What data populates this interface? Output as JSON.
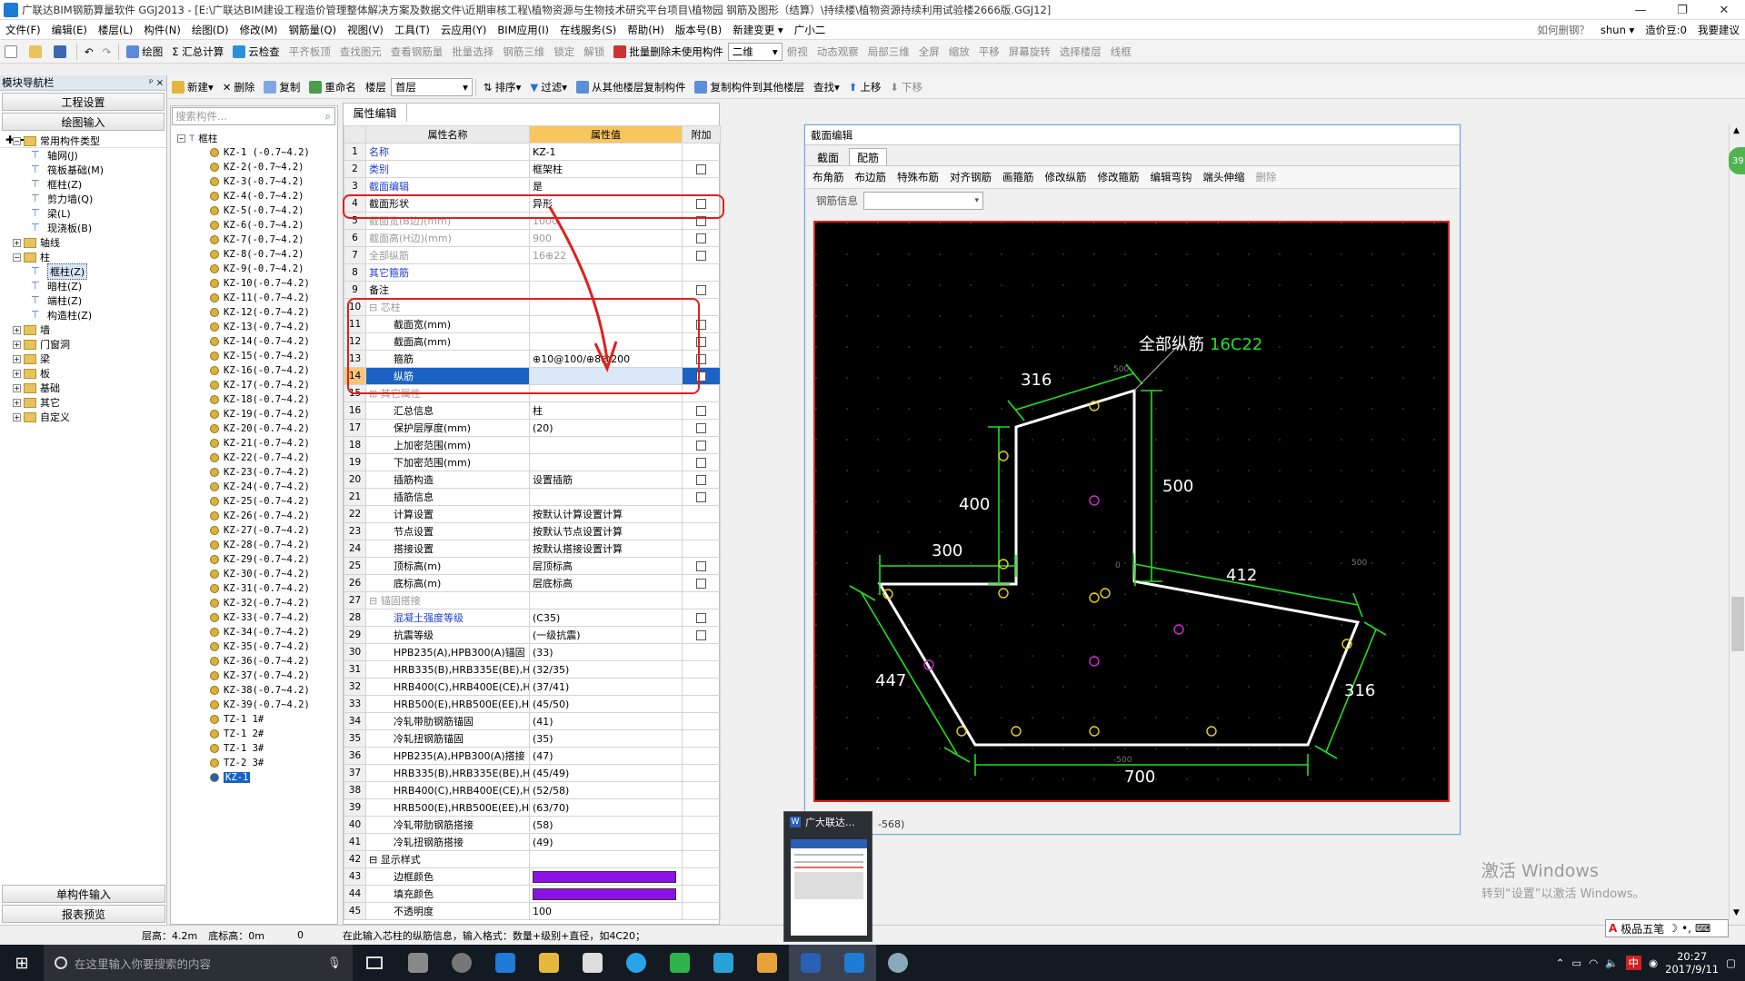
{
  "title": "广联达BIM钢筋算量软件 GGJ2013 - [E:\\广联达BIM建设工程造价管理整体解决方案及数据文件\\近期审核工程\\植物资源与生物技术研究平台项目\\植物园 钢筋及图形（结算）\\持续楼\\植物资源持续利用试验楼2666版.GGJ12]",
  "menu": [
    "文件(F)",
    "编辑(E)",
    "楼层(L)",
    "构件(N)",
    "绘图(D)",
    "修改(M)",
    "钢筋量(Q)",
    "视图(V)",
    "工具(T)",
    "云应用(Y)",
    "BIM应用(I)",
    "在线服务(S)",
    "帮助(H)",
    "版本号(B)",
    "新建变更 ▾",
    "广小二"
  ],
  "menu_right": {
    "help": "如何删钢？",
    "user": "shun ▾",
    "cost": "造价豆:0",
    "ask": "我要建议"
  },
  "toolbar1": [
    "绘图",
    "Σ 汇总计算",
    "云检查",
    "平齐板顶",
    "查找图元",
    "查看钢筋量",
    "批量选择",
    "钢筋三维",
    "锁定",
    "解锁",
    "批量删除未使用构件",
    "二维",
    "俯视",
    "动态观察",
    "局部三维",
    "全屏",
    "缩放",
    "平移",
    "屏幕旋转",
    "选择楼层",
    "线框"
  ],
  "toolbar2": [
    "新建",
    "删除",
    "复制",
    "重命名",
    "楼层",
    "首层",
    "排序",
    "过滤",
    "从其他楼层复制构件",
    "复制构件到其他楼层",
    "查找",
    "上移",
    "下移"
  ],
  "nav": {
    "header": "模块导航栏",
    "pin": "ᵖ ×",
    "btn1": "工程设置",
    "btn2": "绘图输入",
    "btn3": "单构件输入",
    "btn4": "报表预览",
    "tree": [
      {
        "l": 0,
        "t": "常用构件类型",
        "f": true
      },
      {
        "l": 2,
        "t": "轴网(J)"
      },
      {
        "l": 2,
        "t": "筏板基础(M)"
      },
      {
        "l": 2,
        "t": "框柱(Z)"
      },
      {
        "l": 2,
        "t": "剪力墙(Q)"
      },
      {
        "l": 2,
        "t": "梁(L)"
      },
      {
        "l": 2,
        "t": "现浇板(B)"
      },
      {
        "l": 0,
        "t": "轴线",
        "f": true,
        "c": true
      },
      {
        "l": 0,
        "t": "柱",
        "f": true
      },
      {
        "l": 2,
        "t": "框柱(Z)",
        "sel": true
      },
      {
        "l": 2,
        "t": "暗柱(Z)"
      },
      {
        "l": 2,
        "t": "端柱(Z)"
      },
      {
        "l": 2,
        "t": "构造柱(Z)"
      },
      {
        "l": 0,
        "t": "墙",
        "f": true,
        "c": true
      },
      {
        "l": 0,
        "t": "门窗洞",
        "f": true,
        "c": true
      },
      {
        "l": 0,
        "t": "梁",
        "f": true,
        "c": true
      },
      {
        "l": 0,
        "t": "板",
        "f": true,
        "c": true
      },
      {
        "l": 0,
        "t": "基础",
        "f": true,
        "c": true
      },
      {
        "l": 0,
        "t": "其它",
        "f": true,
        "c": true
      },
      {
        "l": 0,
        "t": "自定义",
        "f": true,
        "c": true
      }
    ]
  },
  "search_placeholder": "搜索构件...",
  "component_root": "框柱",
  "components": [
    "KZ-1 (-0.7~4.2)",
    "KZ-2(-0.7~4.2)",
    "KZ-3(-0.7~4.2)",
    "KZ-4(-0.7~4.2)",
    "KZ-5(-0.7~4.2)",
    "KZ-6(-0.7~4.2)",
    "KZ-7(-0.7~4.2)",
    "KZ-8(-0.7~4.2)",
    "KZ-9(-0.7~4.2)",
    "KZ-10(-0.7~4.2)",
    "KZ-11(-0.7~4.2)",
    "KZ-12(-0.7~4.2)",
    "KZ-13(-0.7~4.2)",
    "KZ-14(-0.7~4.2)",
    "KZ-15(-0.7~4.2)",
    "KZ-16(-0.7~4.2)",
    "KZ-17(-0.7~4.2)",
    "KZ-18(-0.7~4.2)",
    "KZ-19(-0.7~4.2)",
    "KZ-20(-0.7~4.2)",
    "KZ-21(-0.7~4.2)",
    "KZ-22(-0.7~4.2)",
    "KZ-23(-0.7~4.2)",
    "KZ-24(-0.7~4.2)",
    "KZ-25(-0.7~4.2)",
    "KZ-26(-0.7~4.2)",
    "KZ-27(-0.7~4.2)",
    "KZ-28(-0.7~4.2)",
    "KZ-29(-0.7~4.2)",
    "KZ-30(-0.7~4.2)",
    "KZ-31(-0.7~4.2)",
    "KZ-32(-0.7~4.2)",
    "KZ-33(-0.7~4.2)",
    "KZ-34(-0.7~4.2)",
    "KZ-35(-0.7~4.2)",
    "KZ-36(-0.7~4.2)",
    "KZ-37(-0.7~4.2)",
    "KZ-38(-0.7~4.2)",
    "KZ-39(-0.7~4.2)",
    "TZ-1 1#",
    "TZ-1 2#",
    "TZ-1 3#",
    "TZ-2 3#",
    "KZ-1"
  ],
  "prop": {
    "tab": "属性编辑",
    "col_name": "属性名称",
    "col_value": "属性值",
    "col_extra": "附加",
    "rows": [
      {
        "n": "1",
        "name": "名称",
        "v": "KZ-1",
        "c": "blue",
        "cb": false
      },
      {
        "n": "2",
        "name": "类别",
        "v": "框架柱",
        "c": "blue",
        "cb": true
      },
      {
        "n": "3",
        "name": "截面编辑",
        "v": "是",
        "c": "blue",
        "cb": false
      },
      {
        "n": "4",
        "name": "截面形状",
        "v": "异形",
        "c": "",
        "cb": true
      },
      {
        "n": "5",
        "name": "截面宽(B边)(mm)",
        "v": "1000",
        "c": "gray",
        "cb": true
      },
      {
        "n": "6",
        "name": "截面高(H边)(mm)",
        "v": "900",
        "c": "gray",
        "cb": true
      },
      {
        "n": "7",
        "name": "全部纵筋",
        "v": "16⊕22",
        "c": "gray",
        "cb": true
      },
      {
        "n": "8",
        "name": "其它箍筋",
        "v": "",
        "c": "blue",
        "cb": false
      },
      {
        "n": "9",
        "name": "备注",
        "v": "",
        "c": "",
        "cb": true
      },
      {
        "n": "10",
        "name": "⊟ 芯柱",
        "v": "",
        "c": "gray",
        "cb": false,
        "grp": true
      },
      {
        "n": "11",
        "name": "截面宽(mm)",
        "v": "",
        "c": "",
        "cb": true,
        "ind": true
      },
      {
        "n": "12",
        "name": "截面高(mm)",
        "v": "",
        "c": "",
        "cb": true,
        "ind": true
      },
      {
        "n": "13",
        "name": "箍筋",
        "v": "⊕10@100/⊕8@200",
        "c": "",
        "cb": true,
        "ind": true
      },
      {
        "n": "14",
        "name": "纵筋",
        "v": "",
        "c": "",
        "cb": true,
        "ind": true,
        "sel": true
      },
      {
        "n": "15",
        "name": "⊞ 其它属性",
        "v": "",
        "c": "gray",
        "cb": false,
        "grp": true
      },
      {
        "n": "16",
        "name": "汇总信息",
        "v": "柱",
        "c": "",
        "cb": true,
        "ind": true
      },
      {
        "n": "17",
        "name": "保护层厚度(mm)",
        "v": "(20)",
        "c": "",
        "cb": true,
        "ind": true
      },
      {
        "n": "18",
        "name": "上加密范围(mm)",
        "v": "",
        "c": "",
        "cb": true,
        "ind": true
      },
      {
        "n": "19",
        "name": "下加密范围(mm)",
        "v": "",
        "c": "",
        "cb": true,
        "ind": true
      },
      {
        "n": "20",
        "name": "插筋构造",
        "v": "设置插筋",
        "c": "",
        "cb": true,
        "ind": true
      },
      {
        "n": "21",
        "name": "插筋信息",
        "v": "",
        "c": "",
        "cb": true,
        "ind": true
      },
      {
        "n": "22",
        "name": "计算设置",
        "v": "按默认计算设置计算",
        "c": "",
        "cb": false,
        "ind": true
      },
      {
        "n": "23",
        "name": "节点设置",
        "v": "按默认节点设置计算",
        "c": "",
        "cb": false,
        "ind": true
      },
      {
        "n": "24",
        "name": "搭接设置",
        "v": "按默认搭接设置计算",
        "c": "",
        "cb": false,
        "ind": true
      },
      {
        "n": "25",
        "name": "顶标高(m)",
        "v": "层顶标高",
        "c": "",
        "cb": true,
        "ind": true
      },
      {
        "n": "26",
        "name": "底标高(m)",
        "v": "层底标高",
        "c": "",
        "cb": true,
        "ind": true
      },
      {
        "n": "27",
        "name": "⊟ 锚固搭接",
        "v": "",
        "c": "gray",
        "cb": false,
        "grp": true
      },
      {
        "n": "28",
        "name": "混凝土强度等级",
        "v": "(C35)",
        "c": "blue",
        "cb": true,
        "ind": true
      },
      {
        "n": "29",
        "name": "抗震等级",
        "v": "(一级抗震)",
        "c": "",
        "cb": true,
        "ind": true
      },
      {
        "n": "30",
        "name": "HPB235(A),HPB300(A)锚固",
        "v": "(33)",
        "c": "",
        "cb": false,
        "ind": true
      },
      {
        "n": "31",
        "name": "HRB335(B),HRB335E(BE),HRBF",
        "v": "(32/35)",
        "c": "",
        "cb": false,
        "ind": true
      },
      {
        "n": "32",
        "name": "HRB400(C),HRB400E(CE),HRBF",
        "v": "(37/41)",
        "c": "",
        "cb": false,
        "ind": true
      },
      {
        "n": "33",
        "name": "HRB500(E),HRB500E(EE),HRBF",
        "v": "(45/50)",
        "c": "",
        "cb": false,
        "ind": true
      },
      {
        "n": "34",
        "name": "冷轧带肋钢筋锚固",
        "v": "(41)",
        "c": "",
        "cb": false,
        "ind": true
      },
      {
        "n": "35",
        "name": "冷轧扭钢筋锚固",
        "v": "(35)",
        "c": "",
        "cb": false,
        "ind": true
      },
      {
        "n": "36",
        "name": "HPB235(A),HPB300(A)搭接",
        "v": "(47)",
        "c": "",
        "cb": false,
        "ind": true
      },
      {
        "n": "37",
        "name": "HRB335(B),HRB335E(BE),HRBF",
        "v": "(45/49)",
        "c": "",
        "cb": false,
        "ind": true
      },
      {
        "n": "38",
        "name": "HRB400(C),HRB400E(CE),HRBF",
        "v": "(52/58)",
        "c": "",
        "cb": false,
        "ind": true
      },
      {
        "n": "39",
        "name": "HRB500(E),HRB500E(EE),HRBF",
        "v": "(63/70)",
        "c": "",
        "cb": false,
        "ind": true
      },
      {
        "n": "40",
        "name": "冷轧带肋钢筋搭接",
        "v": "(58)",
        "c": "",
        "cb": false,
        "ind": true
      },
      {
        "n": "41",
        "name": "冷轧扭钢筋搭接",
        "v": "(49)",
        "c": "",
        "cb": false,
        "ind": true
      },
      {
        "n": "42",
        "name": "⊟ 显示样式",
        "v": "",
        "c": "",
        "cb": false,
        "grp": true
      },
      {
        "n": "43",
        "name": "边框颜色",
        "v": "",
        "c": "",
        "cb": false,
        "ind": true,
        "color": true
      },
      {
        "n": "44",
        "name": "填充颜色",
        "v": "",
        "c": "",
        "cb": false,
        "ind": true,
        "color": true
      },
      {
        "n": "45",
        "name": "不透明度",
        "v": "100",
        "c": "",
        "cb": false,
        "ind": true
      }
    ]
  },
  "section": {
    "caption": "截面编辑",
    "tab1": "截面",
    "tab2": "配筋",
    "tools": [
      "布角筋",
      "布边筋",
      "特殊布筋",
      "对齐钢筋",
      "画箍筋",
      "修改纵筋",
      "修改箍筋",
      "编辑弯钩",
      "端头伸缩",
      "删除"
    ],
    "rebar_info": "钢筋信息",
    "status": "-568)",
    "label_all": "全部纵筋",
    "label_all_val": "16C22",
    "dims": {
      "d316a": "316",
      "d500": "500",
      "d400": "400",
      "d300": "300",
      "d412": "412",
      "d447": "447",
      "d316b": "316",
      "d700": "700"
    },
    "grid_labels": {
      "g500a": "500",
      "g500b": "500",
      "g0": "0",
      "g500c": "-500"
    }
  },
  "statusbar": {
    "floor_h": "层高：4.2m",
    "bottom_h": "底标高：0m",
    "zero": "0",
    "hint": "在此输入芯柱的纵筋信息，输入格式：数量+级别+直径，如4C20；"
  },
  "preview_title": "广大联达...",
  "watermark": {
    "a": "激活 Windows",
    "b": "转到“设置”以激活 Windows。"
  },
  "ime": "极品五笔",
  "taskbar": {
    "search": "在这里输入你要搜索的内容",
    "time": "20:27",
    "date": "2017/9/11",
    "lang": "中",
    "badge": "39"
  }
}
